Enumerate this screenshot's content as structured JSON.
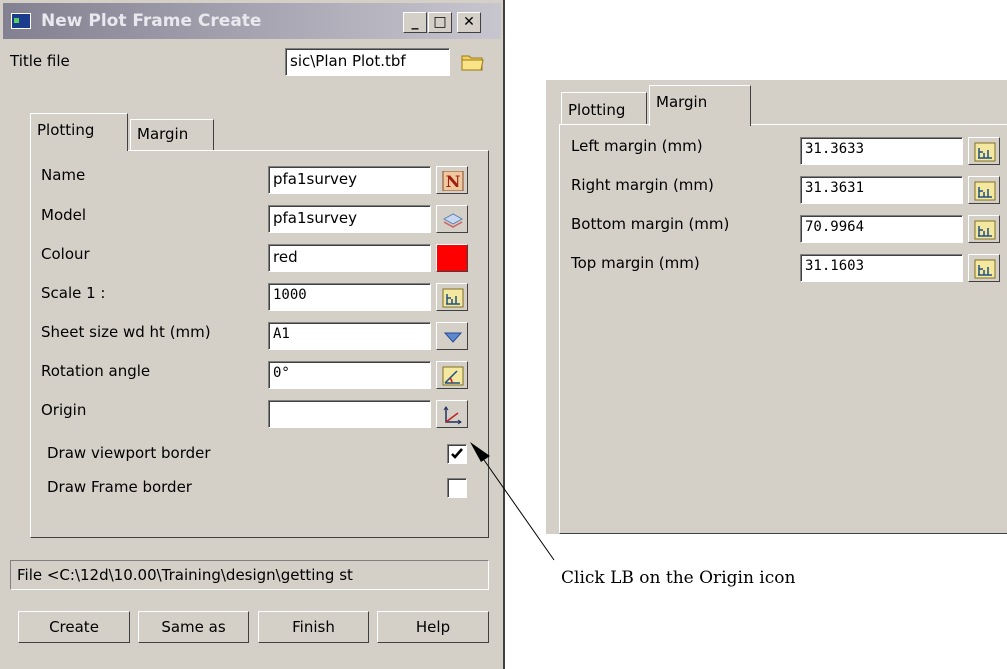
{
  "window": {
    "title": "New Plot Frame Create",
    "minimize": "_",
    "maximize": "□",
    "close": "✕"
  },
  "title_file": {
    "label": "Title file",
    "value": "sic\\Plan Plot.tbf"
  },
  "tabs": [
    {
      "label": "Plotting",
      "active": true
    },
    {
      "label": "Margin",
      "active": false
    }
  ],
  "plotting": {
    "name": {
      "label": "Name",
      "value": "pfa1survey"
    },
    "model": {
      "label": "Model",
      "value": "pfa1survey"
    },
    "colour": {
      "label": "Colour",
      "value": "red",
      "swatch": "#ff0000"
    },
    "scale": {
      "label": "Scale 1 :",
      "value": "1000"
    },
    "sheet_size": {
      "label": "Sheet size wd ht (mm)",
      "value": "A1"
    },
    "rotation": {
      "label": "Rotation angle",
      "value": "0°"
    },
    "origin": {
      "label": "Origin",
      "value": ""
    },
    "draw_viewport_border": {
      "label": "Draw viewport border",
      "checked": true
    },
    "draw_frame_border": {
      "label": "Draw Frame border",
      "checked": false
    }
  },
  "status": "File <C:\\12d\\10.00\\Training\\design\\getting st",
  "buttons": {
    "create": "Create",
    "same_as": "Same as",
    "finish": "Finish",
    "help": "Help"
  },
  "margin_panel": {
    "tabs": [
      {
        "label": "Plotting",
        "active": false
      },
      {
        "label": "Margin",
        "active": true
      }
    ],
    "left": {
      "label": "Left margin (mm)",
      "value": "31.3633"
    },
    "right": {
      "label": "Right margin (mm)",
      "value": "31.3631"
    },
    "bottom": {
      "label": "Bottom margin (mm)",
      "value": "70.9964"
    },
    "top": {
      "label": "Top margin (mm)",
      "value": "31.1603"
    }
  },
  "annotation": "Click LB on the Origin icon",
  "icons": {
    "folder": "folder-icon",
    "name": "n-letter-icon",
    "model": "layers-icon",
    "scale": "measure-icon",
    "sheet": "dropdown-arrow-icon",
    "rotation": "angle-icon",
    "origin": "axes-pick-icon"
  }
}
